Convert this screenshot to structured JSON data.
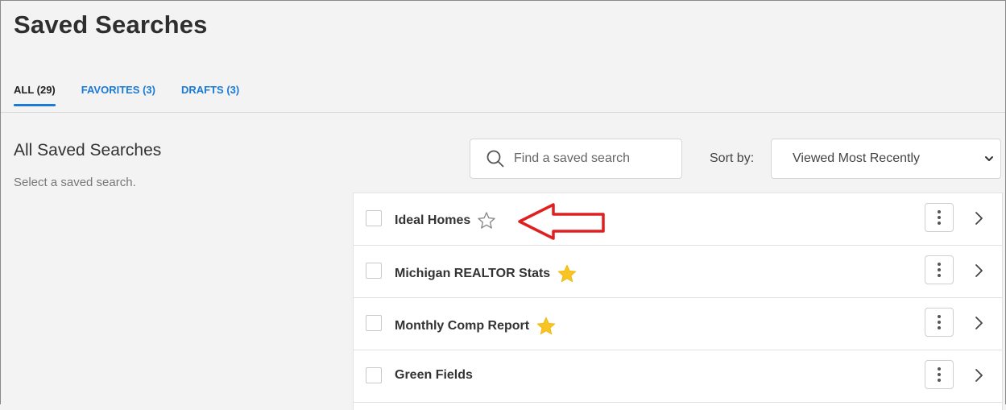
{
  "page": {
    "title": "Saved Searches"
  },
  "tabs": [
    {
      "label": "ALL (29)",
      "active": true
    },
    {
      "label": "FAVORITES (3)",
      "active": false
    },
    {
      "label": "DRAFTS (3)",
      "active": false
    }
  ],
  "section": {
    "title": "All Saved Searches",
    "subtitle": "Select a saved search."
  },
  "search": {
    "placeholder": "Find a saved search",
    "value": ""
  },
  "sort": {
    "label": "Sort by:",
    "selected": "Viewed Most Recently"
  },
  "searches": [
    {
      "name": "Ideal Homes",
      "favorite": false
    },
    {
      "name": "Michigan REALTOR Stats",
      "favorite": true
    },
    {
      "name": "Monthly Comp Report",
      "favorite": true
    },
    {
      "name": "Green Fields",
      "favorite": null
    }
  ],
  "colors": {
    "accent": "#1a7ad6",
    "star_filled": "#f7c325",
    "star_outline": "#8a8a8a",
    "annotation_red": "#e02020",
    "background": "#f3f3f3"
  },
  "icons": {
    "search": "search-icon",
    "dropdown": "chevron-down-icon",
    "favorite_filled": "star-filled-icon",
    "favorite_empty": "star-outline-icon",
    "more": "kebab-menu-icon",
    "open": "chevron-right-icon",
    "annotation": "red-arrow-annotation"
  }
}
